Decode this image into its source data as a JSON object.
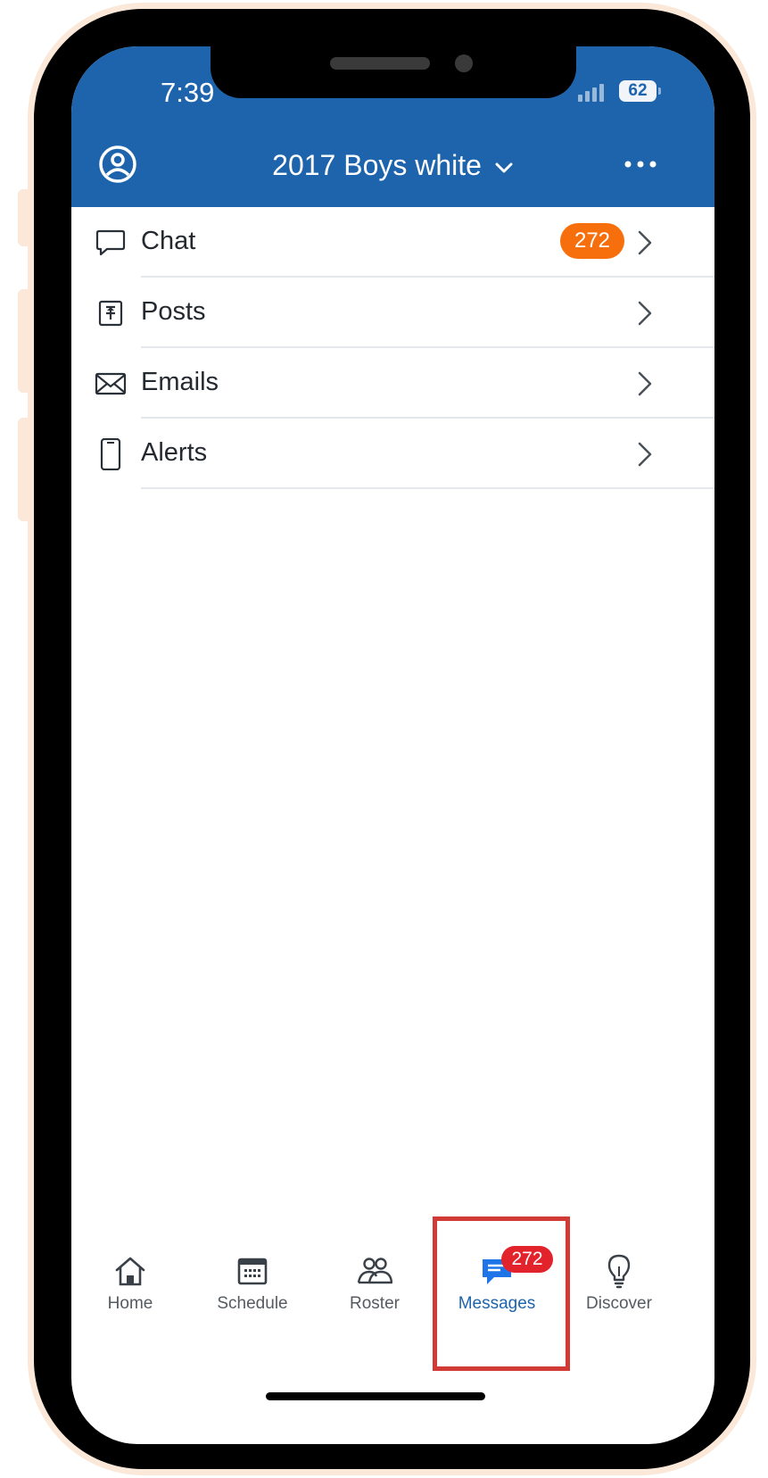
{
  "status_bar": {
    "time": "7:39",
    "battery": "62"
  },
  "header": {
    "team_name": "2017 Boys white",
    "avatar_icon": "account-circle-icon",
    "more_icon": "more-horizontal-icon",
    "background_color": "#1e64ad"
  },
  "menu": {
    "items": [
      {
        "label": "Chat",
        "icon": "chat-bubble-icon",
        "badge": "272"
      },
      {
        "label": "Posts",
        "icon": "pin-icon"
      },
      {
        "label": "Emails",
        "icon": "envelope-icon"
      },
      {
        "label": "Alerts",
        "icon": "phone-device-icon"
      }
    ],
    "badge_color": "#f76e0c"
  },
  "tabbar": {
    "tabs": [
      {
        "label": "Home",
        "icon": "home-icon"
      },
      {
        "label": "Schedule",
        "icon": "calendar-icon"
      },
      {
        "label": "Roster",
        "icon": "people-icon"
      },
      {
        "label": "Messages",
        "icon": "messages-icon",
        "badge": "272",
        "active": true
      },
      {
        "label": "Discover",
        "icon": "lightbulb-icon"
      }
    ],
    "active_color": "#1e64ad",
    "badge_color": "#e3232c"
  },
  "highlight": {
    "color": "#d23b35",
    "target": "Messages"
  }
}
